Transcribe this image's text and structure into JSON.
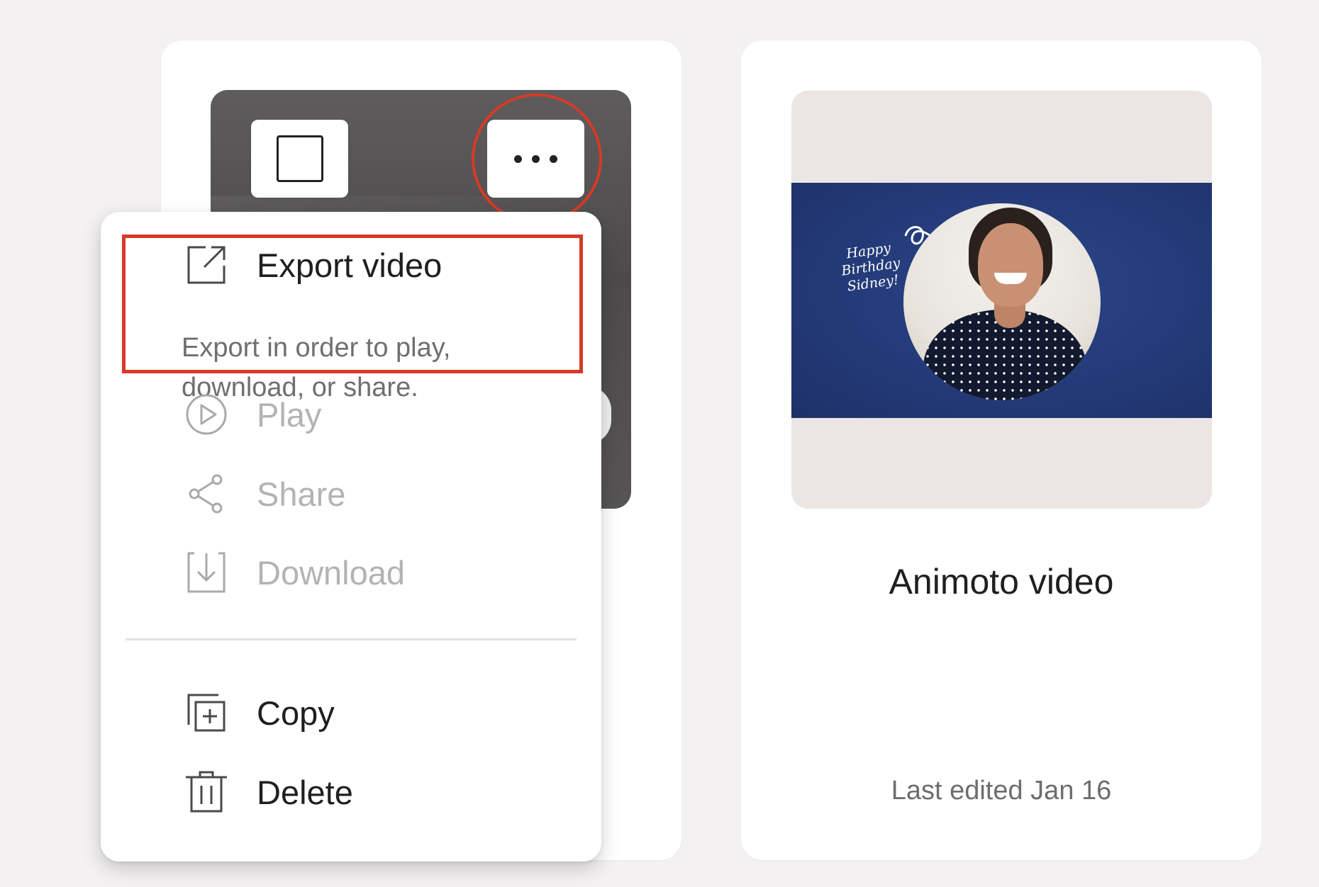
{
  "menu": {
    "export": {
      "label": "Export video",
      "description": "Export in order to play, download, or share.",
      "icon": "export-icon"
    },
    "play": {
      "label": "Play",
      "icon": "play-circle-icon",
      "disabled": true
    },
    "share": {
      "label": "Share",
      "icon": "share-icon",
      "disabled": true
    },
    "download": {
      "label": "Download",
      "icon": "download-icon",
      "disabled": true
    },
    "copy": {
      "label": "Copy",
      "icon": "copy-icon"
    },
    "delete": {
      "label": "Delete",
      "icon": "trash-icon"
    }
  },
  "cards": [
    {
      "select_icon": "checkbox-icon",
      "more_icon": "more-dots-icon"
    },
    {
      "thumbnail_text": "Happy Birthday Sidney!",
      "title": "Animoto video",
      "last_edited": "Last edited Jan 16"
    }
  ],
  "annotation_color": "#d63a26"
}
